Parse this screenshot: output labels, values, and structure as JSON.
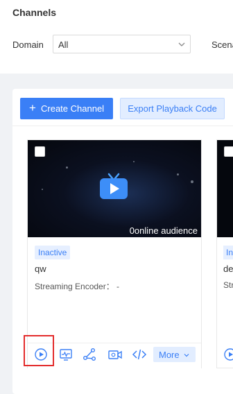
{
  "page": {
    "title": "Channels"
  },
  "filters": {
    "domain_label": "Domain",
    "domain_value": "All",
    "scene_label": "Scena"
  },
  "toolbar": {
    "create_label": "Create Channel",
    "export_label": "Export Playback Code"
  },
  "cards": [
    {
      "status": "Inactive",
      "name": "qw",
      "audience": "0online audience",
      "encoder": "Streaming Encoder： -",
      "more_label": "More"
    },
    {
      "status": "In",
      "name": "de",
      "encoder": "Str"
    }
  ],
  "colors": {
    "primary": "#3a7ff6",
    "highlight": "#e32b2b",
    "tag_bg": "#e6efff"
  },
  "icons": [
    "chevron-down-icon",
    "plus-icon",
    "tv-icon",
    "play-icon",
    "monitor-icon",
    "share-icon",
    "camera-icon",
    "code-icon"
  ]
}
